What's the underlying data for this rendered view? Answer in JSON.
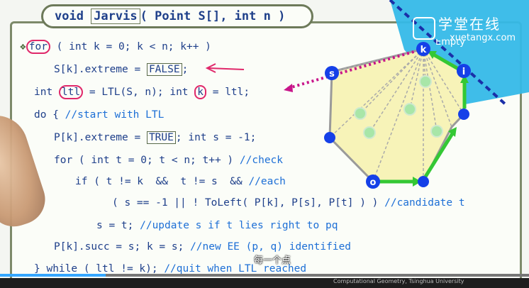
{
  "slide": {
    "title_pre": "void ",
    "title_fn": "Jarvis",
    "title_post": "( Point S[], int n )",
    "lines": [
      {
        "text": "for ( int k = 0; k < n; k++ )"
      },
      {
        "pre": "S[k].extreme = ",
        "box": "FALSE",
        "post": ";"
      },
      {
        "pre": "int ",
        "c1": "ltl",
        "mid": " = LTL(S, n); int ",
        "c2": "k",
        "post": " = ltl;"
      },
      {
        "pre": "do { ",
        "comment": "//start with LTL"
      },
      {
        "pre": "P[k].extreme = ",
        "box": "TRUE",
        "post": "; int s = -1;"
      },
      {
        "pre": "for ( int t = 0; t < n; t++ ) ",
        "comment": "//check"
      },
      {
        "pre": "if ( t != k  &&  t != s  && ",
        "comment": "//each"
      },
      {
        "pre": "( s == -1 || ! ToLeft( P[k], P[s], P[t] ) ) ",
        "comment": "//candidate t"
      },
      {
        "pre": "s = t; ",
        "comment": "//update s if t lies right to pq"
      },
      {
        "pre": "P[k].succ = s; k = s; ",
        "comment": "//new EE (p, q) identified"
      },
      {
        "pre": "} while ( ltl != k); ",
        "comment": "//quit when LTL reached"
      }
    ],
    "for_marker": "❖",
    "for_keyword": "for"
  },
  "diagram": {
    "labels": {
      "k": "k",
      "s": "s",
      "i": "i",
      "o": "o"
    },
    "empty_text": "Empty"
  },
  "logo": {
    "cn": "学堂在线",
    "en": "xuetangx.com"
  },
  "subtitle": "每一个点",
  "credit": "Computational Geometry, Tsinghua University",
  "video": {
    "progress": 0.2
  },
  "colors": {
    "code": "#1e3f8a",
    "comment": "#1d6fd6",
    "highlight": "#e0286a",
    "hull_fill": "#f7f3b8",
    "hull_edge": "#34c834",
    "vertex": "#1540e8",
    "logo_bg": "#35b9e8"
  }
}
